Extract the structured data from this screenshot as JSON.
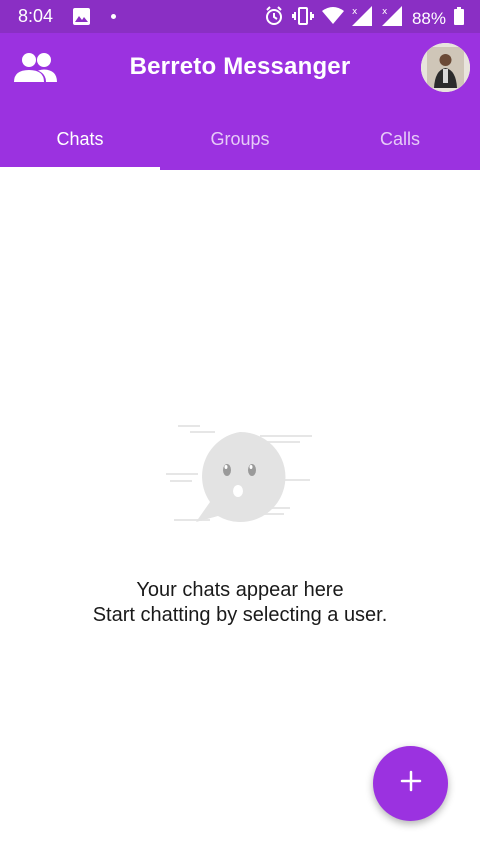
{
  "status_bar": {
    "time": "8:04",
    "battery_percent": "88%",
    "icons": [
      "image-icon",
      "notification-dot",
      "alarm-icon",
      "vibrate-icon",
      "wifi-icon",
      "signal-icon",
      "signal-icon",
      "battery-icon"
    ]
  },
  "header": {
    "title": "Berreto Messanger",
    "left_icon": "people-icon",
    "right_icon": "profile-avatar"
  },
  "tabs": [
    {
      "label": "Chats",
      "active": true
    },
    {
      "label": "Groups",
      "active": false
    },
    {
      "label": "Calls",
      "active": false
    }
  ],
  "empty_state": {
    "line1": "Your chats appear here",
    "line2": "Start chatting by selecting a user."
  },
  "fab": {
    "icon": "plus-icon"
  },
  "colors": {
    "status_bar": "#8a2fc4",
    "app_bar": "#9b32e0",
    "fab": "#9b32e0",
    "text": "#1a1a1a"
  }
}
